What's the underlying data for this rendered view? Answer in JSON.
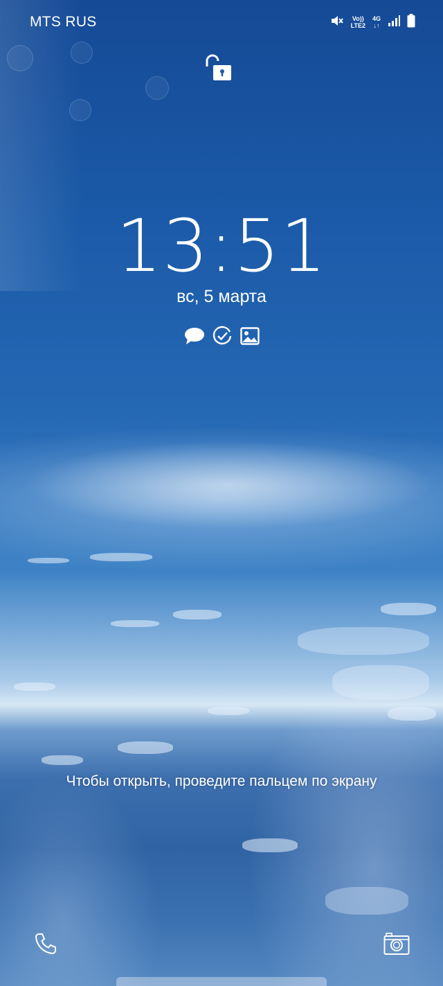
{
  "status_bar": {
    "carrier": "MTS RUS",
    "volte_top": "Vo))",
    "volte_bottom": "LTE2",
    "network": "4G",
    "icons": [
      "mute-icon",
      "volte-icon",
      "4g-icon",
      "signal-icon",
      "battery-icon"
    ]
  },
  "lockscreen": {
    "lock_icon": "unlocked-padlock-icon",
    "time": "13:51",
    "date": "вс, 5 марта",
    "notification_icons": [
      "chat-bubble-icon",
      "checkmark-clock-icon",
      "gallery-icon"
    ],
    "unlock_hint": "Чтобы открыть, проведите пальцем по экрану"
  },
  "shortcuts": {
    "left": "phone-icon",
    "right": "camera-icon"
  },
  "colors": {
    "sky_top": "#154a96",
    "sky_mid": "#2568b4",
    "horizon": "#d7e7f5",
    "foreground": "#ffffff"
  }
}
